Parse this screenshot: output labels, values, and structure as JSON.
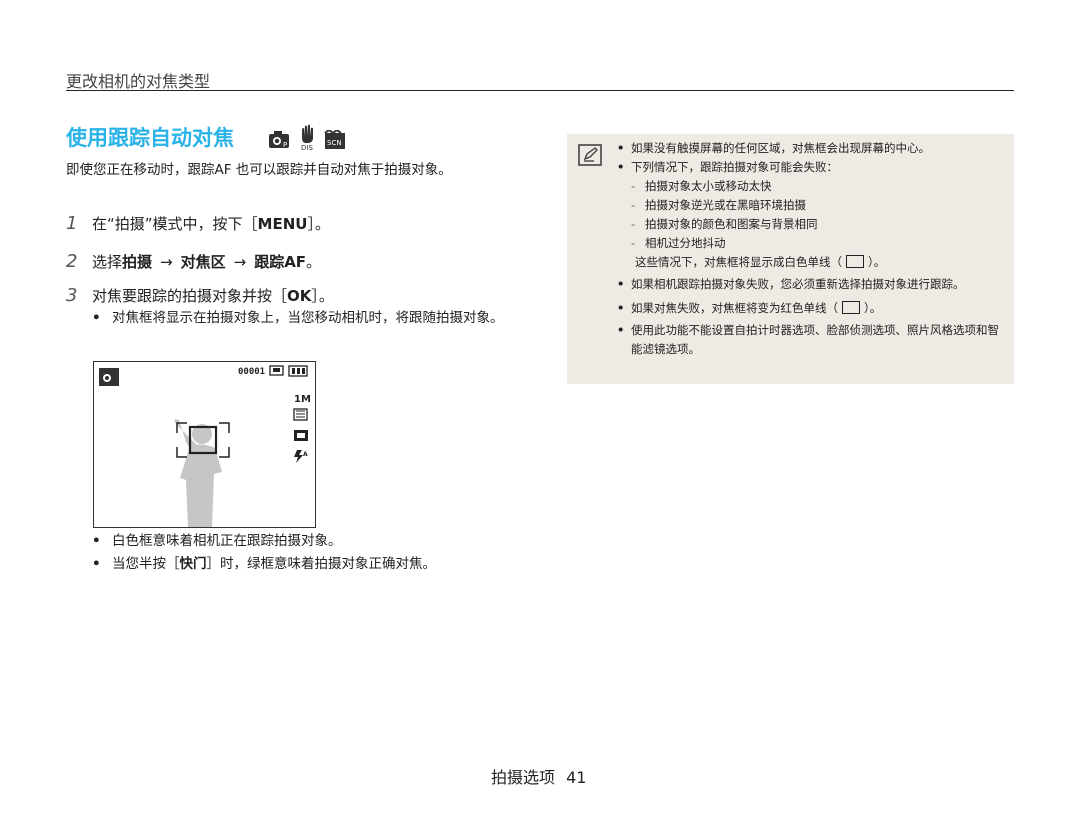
{
  "section": {
    "title": "更改相机的对焦类型"
  },
  "heading": {
    "title": "使用跟踪自动对焦"
  },
  "intro": "即使您正在移动时，跟踪AF 也可以跟踪并自动对焦于拍摄对象。",
  "steps": [
    {
      "num": "1",
      "text_a": "在“拍摄”模式中，按下［",
      "key": "MENU",
      "text_b": "］。"
    },
    {
      "num": "2",
      "text_a": "选择",
      "item1": "拍摄",
      "arrow1": "→",
      "item2": "对焦区",
      "arrow2": "→",
      "item3": "跟踪AF",
      "text_b": "。"
    },
    {
      "num": "3",
      "text_a": "对焦要跟踪的拍摄对象并按［",
      "key": "OK",
      "text_b": "］。"
    }
  ],
  "step3_note": "对焦框将显示在拍摄对象上，当您移动相机时，将跟随拍摄对象。",
  "screen": {
    "counter": "00001",
    "size_label": "1M"
  },
  "bottom_bullets": [
    "白色框意味着相机正在跟踪拍摄对象。",
    {
      "a": "当您半按［",
      "key": "快门",
      "b": "］时，绿框意味着拍摄对象正确对焦。"
    }
  ],
  "note": {
    "item1": "如果没有触摸屏幕的任何区域，对焦框会出现屏幕的中心。",
    "item2": "下列情况下，跟踪拍摄对象可能会失败：",
    "subitems": [
      "拍摄对象太小或移动太快",
      "拍摄对象逆光或在黑暗环境拍摄",
      "拍摄对象的颜色和图案与背景相同",
      "相机过分地抖动"
    ],
    "item2_tail_a": "这些情况下，对焦框将显示成白色单线（",
    "item2_tail_b": "）。",
    "item3": "如果相机跟踪拍摄对象失败，您必须重新选择拍摄对象进行跟踪。",
    "item4_a": "如果对焦失败，对焦框将变为红色单线（",
    "item4_b": "）。",
    "item5": "使用此功能不能设置自拍计时器选项、脸部侦测选项、照片风格选项和智能滤镜选项。"
  },
  "footer": {
    "label": "拍摄选项",
    "page": "41"
  },
  "colors": {
    "heading": "#2bb3e8",
    "note_bg": "#efebe4"
  }
}
